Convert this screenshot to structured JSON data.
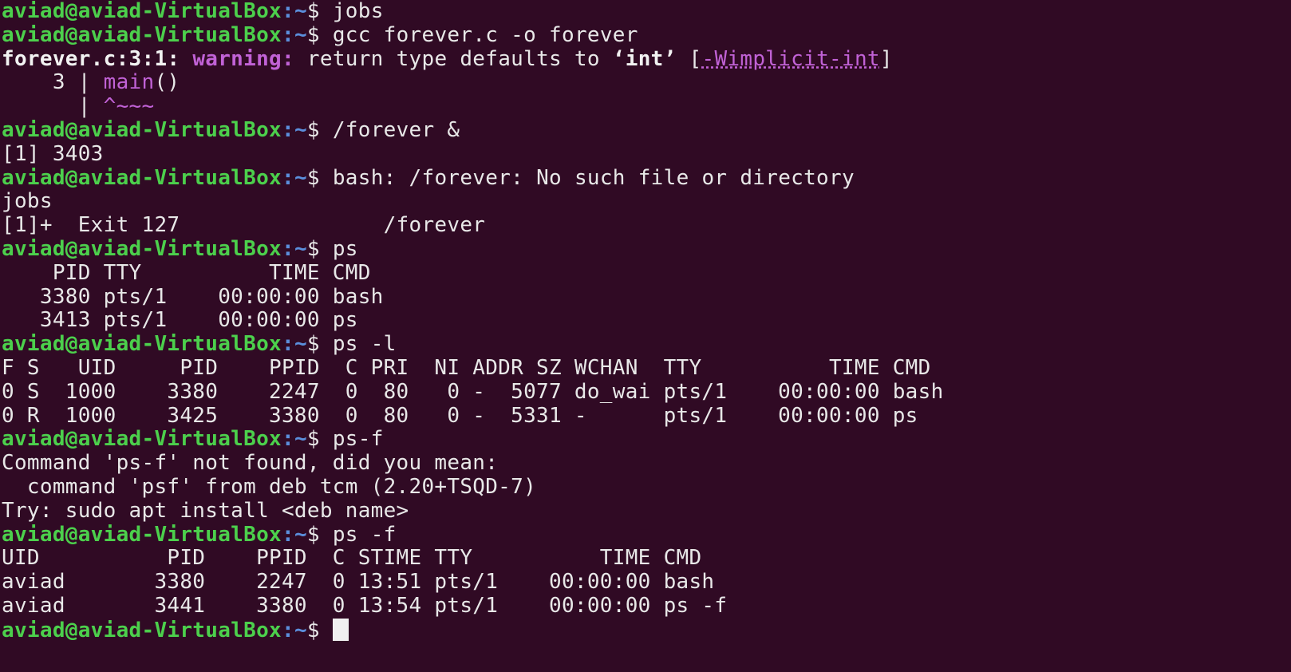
{
  "prompt": {
    "user_host": "aviad@aviad-VirtualBox",
    "path": ":~",
    "symbol": "$ "
  },
  "lines": [
    {
      "type": "prompt",
      "cmd": "jobs"
    },
    {
      "type": "prompt",
      "cmd": "gcc forever.c -o forever"
    },
    {
      "type": "warning",
      "loc": "forever.c:3:1:",
      "label": " warning:",
      "msg_a": " return type defaults to ",
      "quoted": "‘int’",
      "msg_b": " [",
      "flag": "-Wimplicit-int",
      "msg_c": "]"
    },
    {
      "type": "code",
      "gutter": "    3 | ",
      "code": "main",
      "rest": "()"
    },
    {
      "type": "code",
      "gutter": "      | ",
      "code": "^~~~",
      "rest": ""
    },
    {
      "type": "prompt",
      "cmd": "/forever &"
    },
    {
      "type": "text",
      "text": "[1] 3403"
    },
    {
      "type": "prompt",
      "cmd": "bash: /forever: No such file or directory"
    },
    {
      "type": "text",
      "text": "jobs"
    },
    {
      "type": "text",
      "text": "[1]+  Exit 127                /forever"
    },
    {
      "type": "prompt",
      "cmd": "ps"
    },
    {
      "type": "text",
      "text": "    PID TTY          TIME CMD"
    },
    {
      "type": "text",
      "text": "   3380 pts/1    00:00:00 bash"
    },
    {
      "type": "text",
      "text": "   3413 pts/1    00:00:00 ps"
    },
    {
      "type": "prompt",
      "cmd": "ps -l"
    },
    {
      "type": "text",
      "text": "F S   UID     PID    PPID  C PRI  NI ADDR SZ WCHAN  TTY          TIME CMD"
    },
    {
      "type": "text",
      "text": "0 S  1000    3380    2247  0  80   0 -  5077 do_wai pts/1    00:00:00 bash"
    },
    {
      "type": "text",
      "text": "0 R  1000    3425    3380  0  80   0 -  5331 -      pts/1    00:00:00 ps"
    },
    {
      "type": "prompt",
      "cmd": "ps-f"
    },
    {
      "type": "text",
      "text": "Command 'ps-f' not found, did you mean:"
    },
    {
      "type": "text",
      "text": "  command 'psf' from deb tcm (2.20+TSQD-7)"
    },
    {
      "type": "text",
      "text": "Try: sudo apt install <deb name>"
    },
    {
      "type": "prompt",
      "cmd": "ps -f"
    },
    {
      "type": "text",
      "text": "UID          PID    PPID  C STIME TTY          TIME CMD"
    },
    {
      "type": "text",
      "text": "aviad       3380    2247  0 13:51 pts/1    00:00:00 bash"
    },
    {
      "type": "text",
      "text": "aviad       3441    3380  0 13:54 pts/1    00:00:00 ps -f"
    },
    {
      "type": "prompt-cursor",
      "cmd": ""
    }
  ]
}
